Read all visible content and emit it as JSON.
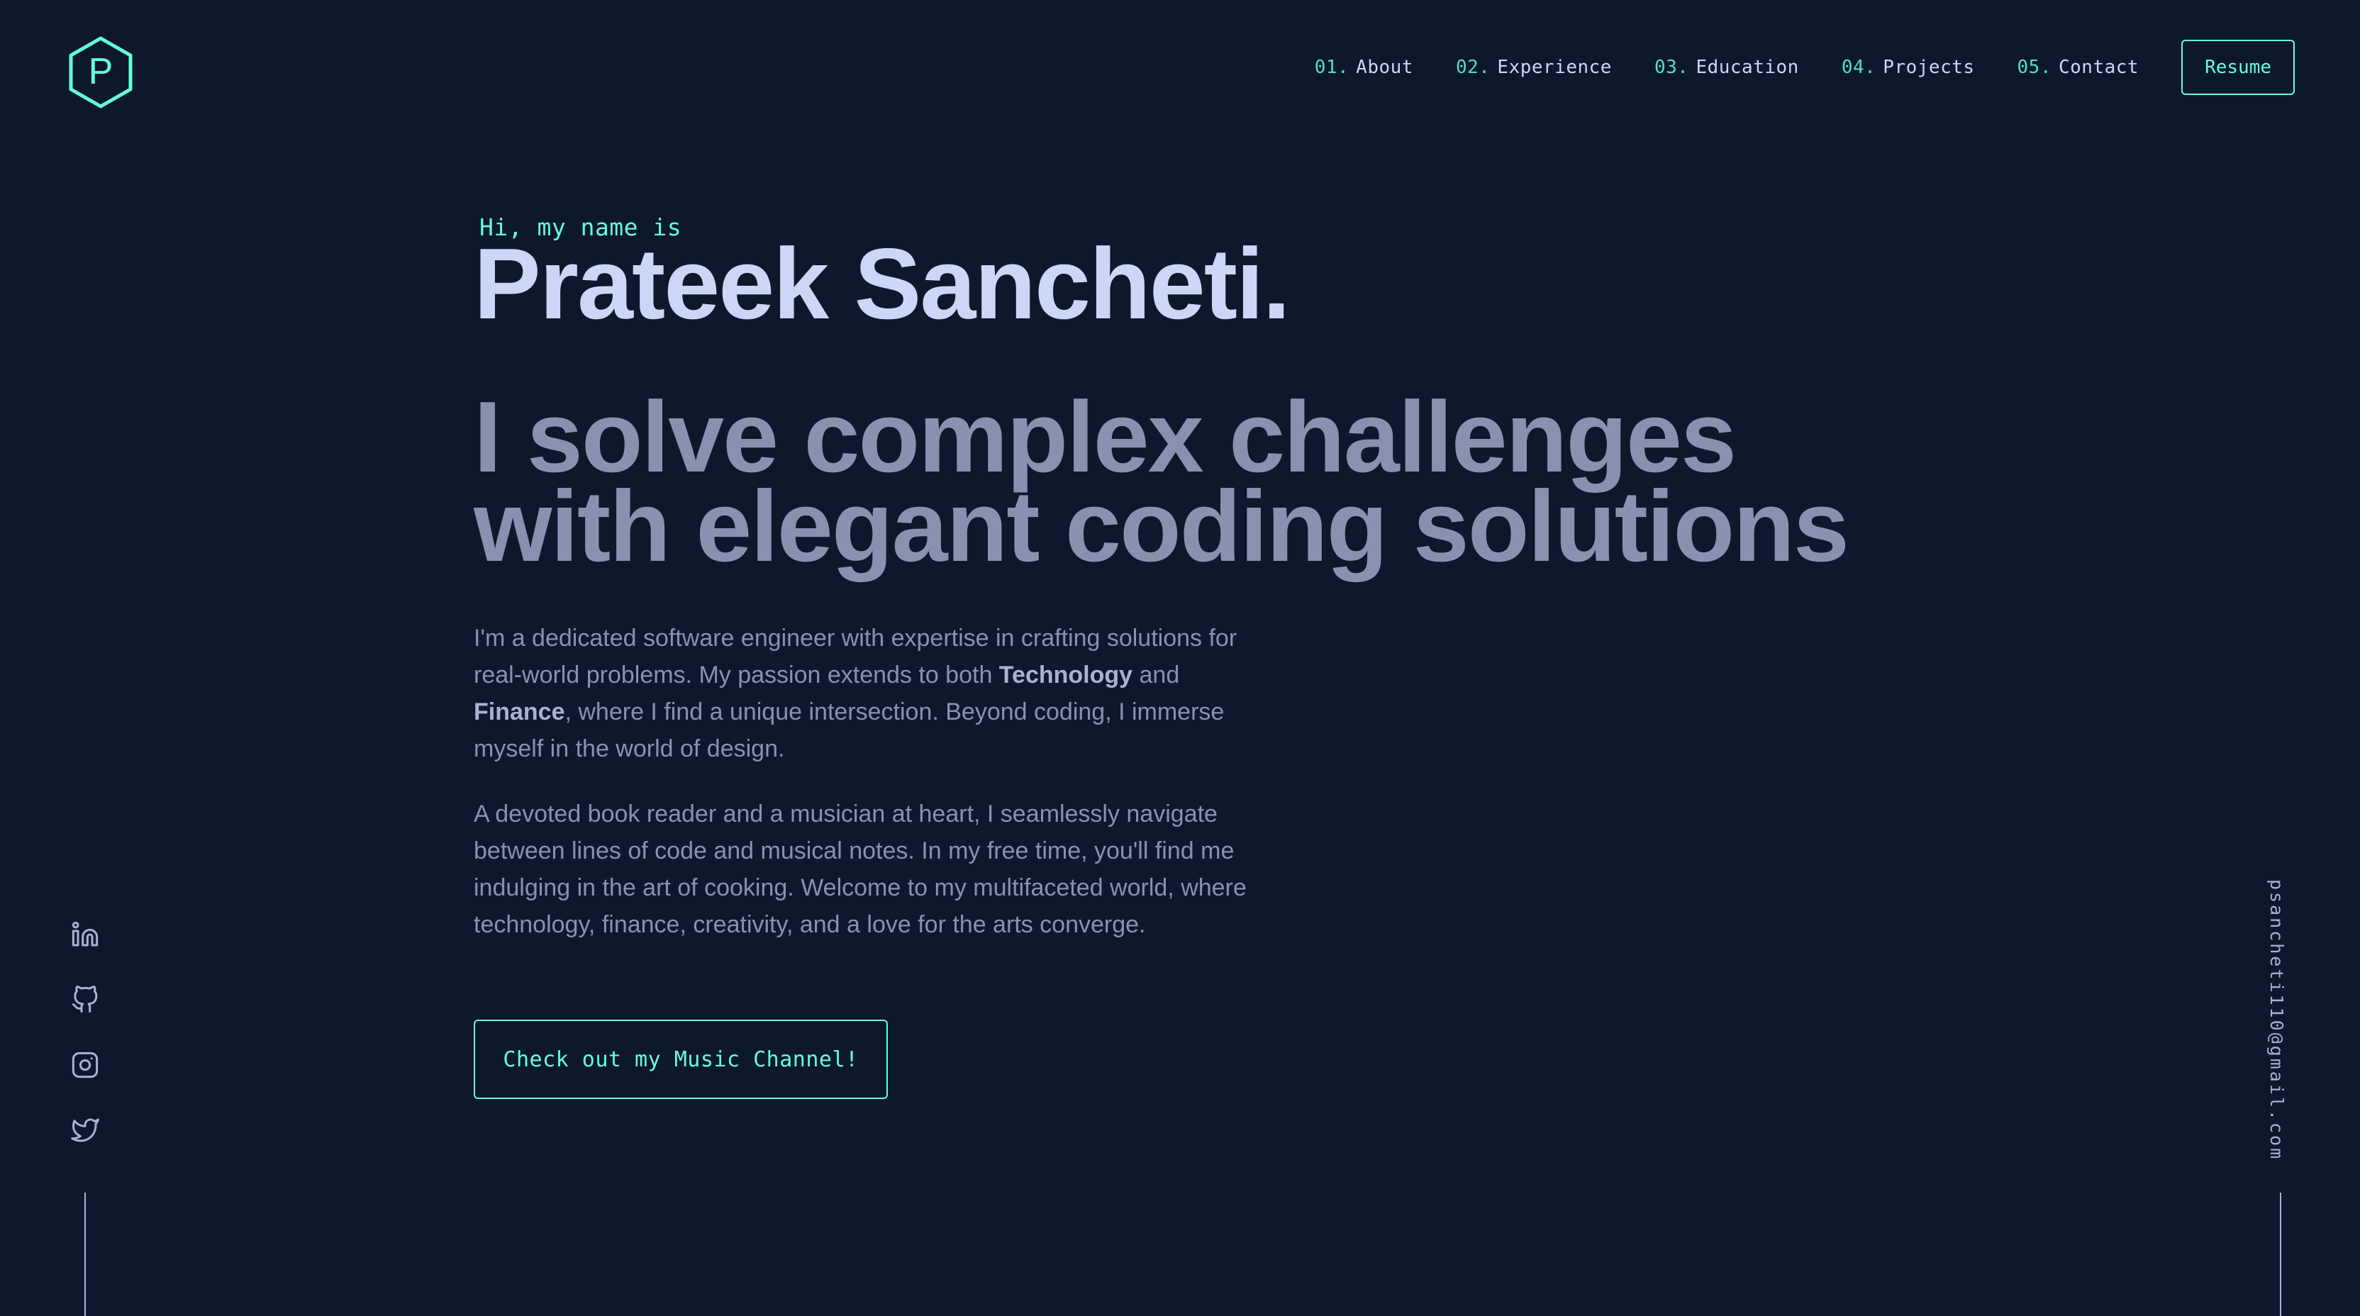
{
  "logo": {
    "letter": "P",
    "icon": "hexagon-logo-icon"
  },
  "nav": {
    "items": [
      {
        "num": "01.",
        "label": "About"
      },
      {
        "num": "02.",
        "label": "Experience"
      },
      {
        "num": "03.",
        "label": "Education"
      },
      {
        "num": "04.",
        "label": "Projects"
      },
      {
        "num": "05.",
        "label": "Contact"
      }
    ],
    "resume_label": "Resume"
  },
  "hero": {
    "greeting": "Hi, my name is",
    "name": "Prateek Sancheti.",
    "tagline_line1": "I solve complex challenges",
    "tagline_line2": "with elegant coding solutions"
  },
  "bio": {
    "p1_part1": "I'm a dedicated software engineer with expertise in crafting solutions for real-world problems. My passion extends to both ",
    "p1_bold1": "Technology",
    "p1_part2": " and ",
    "p1_bold2": "Finance",
    "p1_part3": ", where I find a unique intersection. Beyond coding, I immerse myself in the world of design.",
    "p2": "A devoted book reader and a musician at heart, I seamlessly navigate between lines of code and musical notes. In my free time, you'll find me indulging in the art of cooking. Welcome to my multifaceted world, where technology, finance, creativity, and a love for the arts converge."
  },
  "cta": {
    "music_label": "Check out my Music Channel!"
  },
  "social": {
    "icons": [
      "linkedin-icon",
      "github-icon",
      "instagram-icon",
      "twitter-icon"
    ]
  },
  "email": "psancheti110@gmail.com",
  "colors": {
    "background": "#0d182c",
    "accent": "#64ffda",
    "heading": "#ccd6f6",
    "body": "#8892b0"
  }
}
